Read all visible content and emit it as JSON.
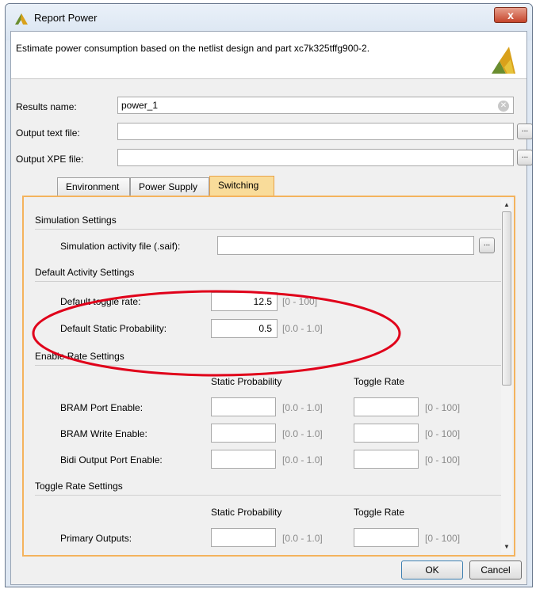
{
  "window": {
    "title": "Report Power",
    "close_label": "x"
  },
  "header": {
    "description": "Estimate power consumption based on the netlist design and part xc7k325tffg900-2."
  },
  "fields": {
    "results_name": {
      "label": "Results name:",
      "value": "power_1"
    },
    "output_text_file": {
      "label": "Output text file:",
      "value": ""
    },
    "output_xpe_file": {
      "label": "Output XPE file:",
      "value": ""
    }
  },
  "tabs": [
    {
      "label": "Environment",
      "active": false
    },
    {
      "label": "Power Supply",
      "active": false
    },
    {
      "label": "Switching",
      "active": true
    }
  ],
  "switching": {
    "simulation_settings": {
      "title": "Simulation Settings",
      "activity_file_label": "Simulation activity file (.saif):",
      "activity_file_value": ""
    },
    "default_activity": {
      "title": "Default Activity Settings",
      "toggle_rate_label": "Default toggle rate:",
      "toggle_rate_value": "12.5",
      "toggle_rate_range": "[0 - 100]",
      "static_prob_label": "Default Static Probability:",
      "static_prob_value": "0.5",
      "static_prob_range": "[0.0 - 1.0]"
    },
    "enable_rate": {
      "title": "Enable Rate Settings",
      "col_static": "Static Probability",
      "col_toggle": "Toggle Rate",
      "rows": [
        {
          "label": "BRAM Port Enable:",
          "static_range": "[0.0 - 1.0]",
          "toggle_range": "[0 - 100]"
        },
        {
          "label": "BRAM Write Enable:",
          "static_range": "[0.0 - 1.0]",
          "toggle_range": "[0 - 100]"
        },
        {
          "label": "Bidi Output Port Enable:",
          "static_range": "[0.0 - 1.0]",
          "toggle_range": "[0 - 100]"
        }
      ]
    },
    "toggle_rate": {
      "title": "Toggle Rate Settings",
      "col_static": "Static Probability",
      "col_toggle": "Toggle Rate",
      "rows": [
        {
          "label": "Primary Outputs:",
          "static_range": "[0.0 - 1.0]",
          "toggle_range": "[0 - 100]"
        }
      ]
    }
  },
  "buttons": {
    "ok": "OK",
    "cancel": "Cancel"
  },
  "colors": {
    "active_tab": "#f9dc9a",
    "panel_border": "#f4b35d",
    "annotation": "#e0001a"
  }
}
